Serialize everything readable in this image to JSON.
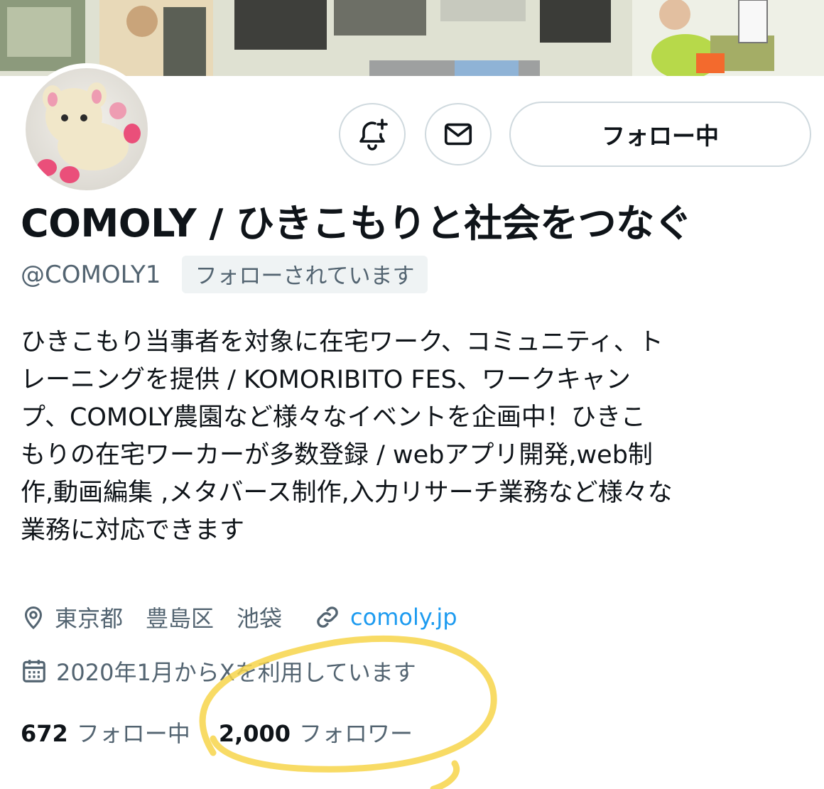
{
  "profile": {
    "display_name": "COMOLY / ひきこもりと社会をつなぐ",
    "handle": "@COMOLY1",
    "follows_you_badge": "フォローされています",
    "bio": "ひきこもり当事者を対象に在宅ワーク、コミュニティ、ト\nレーニングを提供 / KOMORIBITO FES、ワークキャン\nプ、COMOLY農園など様々なイベントを企画中！ひきこ\nもりの在宅ワーカーが多数登録 / webアプリ開発,web制\n作,動画編集 ,メタバース制作,入力リサーチ業務など様々な\n業務に対応できます",
    "location": "東京都　豊島区　池袋",
    "website": "comoly.jp",
    "joined": "2020年1月からXを利用しています"
  },
  "actions": {
    "follow_button_label": "フォロー中"
  },
  "stats": {
    "following_count": "672",
    "following_label": "フォロー中",
    "followers_count": "2,000",
    "followers_label": "フォロワー"
  },
  "icons": {
    "notify": "bell-plus-icon",
    "message": "envelope-icon",
    "location": "map-pin-icon",
    "link": "link-icon",
    "calendar": "calendar-icon"
  },
  "colors": {
    "text_primary": "#0f1419",
    "text_secondary": "#536471",
    "link": "#1d9bf0",
    "border": "#cfd9de",
    "highlight_marker": "#f7d54a"
  }
}
